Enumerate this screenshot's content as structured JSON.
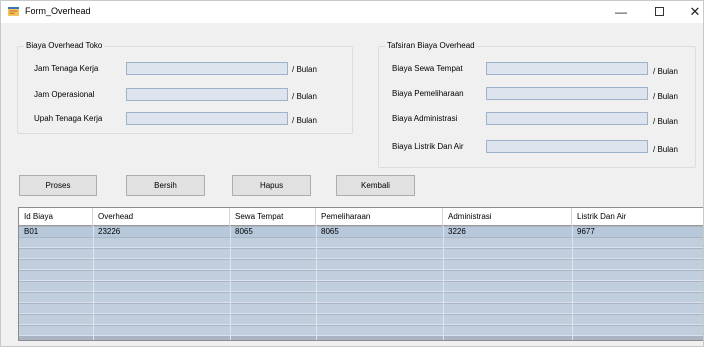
{
  "window": {
    "title": "Form_Overhead"
  },
  "titlebar_buttons": {
    "minimize": "—",
    "close": "✕"
  },
  "group_toko": {
    "title": "Biaya Overhead Toko",
    "fields": [
      {
        "label": "Jam Tenaga Kerja",
        "value": "",
        "unit": "/ Bulan"
      },
      {
        "label": "Jam Operasional",
        "value": "",
        "unit": "/ Bulan"
      },
      {
        "label": "Upah Tenaga Kerja",
        "value": "",
        "unit": "/ Bulan"
      }
    ]
  },
  "group_tafsiran": {
    "title": "Tafsiran Biaya Overhead",
    "fields": [
      {
        "label": "Biaya Sewa Tempat",
        "value": "",
        "unit": "/ Bulan"
      },
      {
        "label": "Biaya Pemeliharaan",
        "value": "",
        "unit": "/ Bulan"
      },
      {
        "label": "Biaya Administrasi",
        "value": "",
        "unit": "/ Bulan"
      },
      {
        "label": "Biaya Listrik Dan Air",
        "value": "",
        "unit": "/ Bulan"
      }
    ]
  },
  "buttons": {
    "proses": "Proses",
    "bersih": "Bersih",
    "hapus": "Hapus",
    "kembali": "Kembali"
  },
  "grid": {
    "columns": [
      "Id Biaya",
      "Overhead",
      "Sewa Tempat",
      "Pemeliharaan",
      "Administrasi",
      "Listrik Dan Air"
    ],
    "rows": [
      [
        "B01",
        "23226",
        "8065",
        "8065",
        "3226",
        "9677"
      ]
    ]
  }
}
